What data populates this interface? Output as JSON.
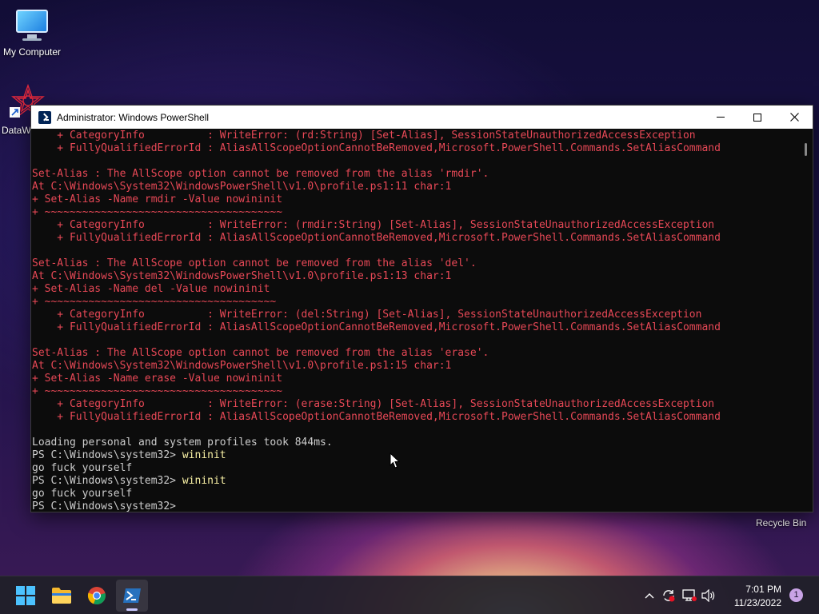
{
  "desktop": {
    "icons": [
      {
        "label": "My Computer"
      },
      {
        "label": "DataW"
      }
    ],
    "recycle_bin_label": "Recycle Bin"
  },
  "window": {
    "title": "Administrator: Windows PowerShell",
    "controls": {
      "minimize": "minimize",
      "maximize": "maximize",
      "close": "close"
    }
  },
  "console": {
    "lines": [
      {
        "text": "    + CategoryInfo          : WriteError: (rd:String) [Set-Alias], SessionStateUnauthorizedAccessException",
        "style": "err"
      },
      {
        "text": "    + FullyQualifiedErrorId : AliasAllScopeOptionCannotBeRemoved,Microsoft.PowerShell.Commands.SetAliasCommand",
        "style": "err"
      },
      {
        "text": "",
        "style": "out"
      },
      {
        "text": "Set-Alias : The AllScope option cannot be removed from the alias 'rmdir'.",
        "style": "err"
      },
      {
        "text": "At C:\\Windows\\System32\\WindowsPowerShell\\v1.0\\profile.ps1:11 char:1",
        "style": "err"
      },
      {
        "text": "+ Set-Alias -Name rmdir -Value nowininit",
        "style": "err"
      },
      {
        "text": "+ ~~~~~~~~~~~~~~~~~~~~~~~~~~~~~~~~~~~~~~",
        "style": "err"
      },
      {
        "text": "    + CategoryInfo          : WriteError: (rmdir:String) [Set-Alias], SessionStateUnauthorizedAccessException",
        "style": "err"
      },
      {
        "text": "    + FullyQualifiedErrorId : AliasAllScopeOptionCannotBeRemoved,Microsoft.PowerShell.Commands.SetAliasCommand",
        "style": "err"
      },
      {
        "text": "",
        "style": "out"
      },
      {
        "text": "Set-Alias : The AllScope option cannot be removed from the alias 'del'.",
        "style": "err"
      },
      {
        "text": "At C:\\Windows\\System32\\WindowsPowerShell\\v1.0\\profile.ps1:13 char:1",
        "style": "err"
      },
      {
        "text": "+ Set-Alias -Name del -Value nowininit",
        "style": "err"
      },
      {
        "text": "+ ~~~~~~~~~~~~~~~~~~~~~~~~~~~~~~~~~~~~~",
        "style": "err"
      },
      {
        "text": "    + CategoryInfo          : WriteError: (del:String) [Set-Alias], SessionStateUnauthorizedAccessException",
        "style": "err"
      },
      {
        "text": "    + FullyQualifiedErrorId : AliasAllScopeOptionCannotBeRemoved,Microsoft.PowerShell.Commands.SetAliasCommand",
        "style": "err"
      },
      {
        "text": "",
        "style": "out"
      },
      {
        "text": "Set-Alias : The AllScope option cannot be removed from the alias 'erase'.",
        "style": "err"
      },
      {
        "text": "At C:\\Windows\\System32\\WindowsPowerShell\\v1.0\\profile.ps1:15 char:1",
        "style": "err"
      },
      {
        "text": "+ Set-Alias -Name erase -Value nowininit",
        "style": "err"
      },
      {
        "text": "+ ~~~~~~~~~~~~~~~~~~~~~~~~~~~~~~~~~~~~~~",
        "style": "err"
      },
      {
        "text": "    + CategoryInfo          : WriteError: (erase:String) [Set-Alias], SessionStateUnauthorizedAccessException",
        "style": "err"
      },
      {
        "text": "    + FullyQualifiedErrorId : AliasAllScopeOptionCannotBeRemoved,Microsoft.PowerShell.Commands.SetAliasCommand",
        "style": "err"
      },
      {
        "text": "",
        "style": "out"
      },
      {
        "text": "Loading personal and system profiles took 844ms.",
        "style": "out"
      },
      {
        "prompt": "PS C:\\Windows\\system32> ",
        "command": "wininit"
      },
      {
        "text": "go fuck yourself",
        "style": "out"
      },
      {
        "prompt": "PS C:\\Windows\\system32> ",
        "command": "wininit"
      },
      {
        "text": "go fuck yourself",
        "style": "out"
      },
      {
        "prompt": "PS C:\\Windows\\system32> ",
        "command": ""
      }
    ],
    "colors": {
      "error": "#e74856",
      "output": "#cccccc",
      "command": "#f9f1a5",
      "background": "#0c0c0c"
    }
  },
  "taskbar": {
    "apps": [
      {
        "name": "start-icon"
      },
      {
        "name": "file-explorer-icon"
      },
      {
        "name": "chrome-icon"
      },
      {
        "name": "powershell-icon",
        "active": true
      }
    ],
    "tray": {
      "time": "7:01 PM",
      "date": "11/23/2022",
      "notification_count": "1"
    }
  }
}
